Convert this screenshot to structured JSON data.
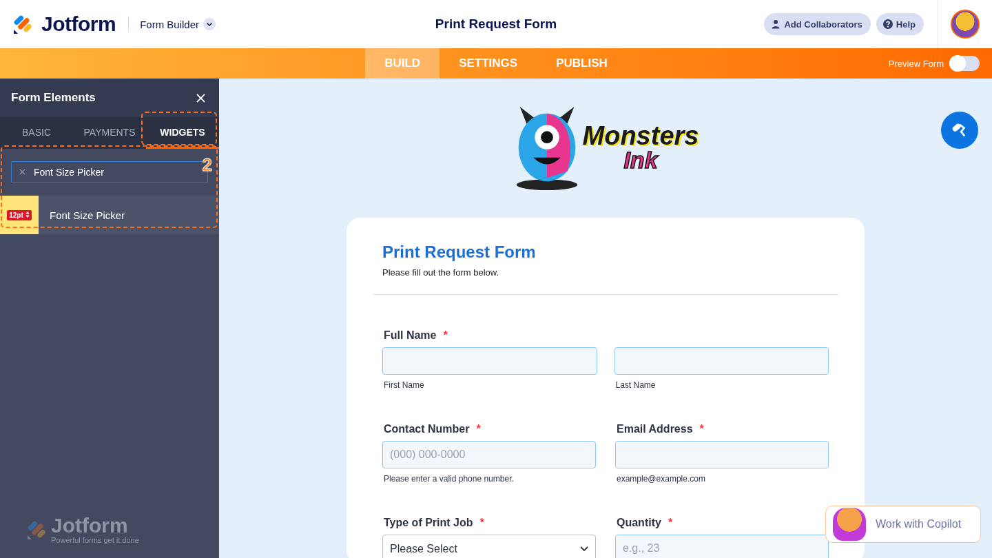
{
  "header": {
    "brand": "Jotform",
    "builder_menu": "Form Builder",
    "title": "Print Request Form",
    "buttons": [
      {
        "kind": "collaborators",
        "label": "Add Collaborators"
      },
      {
        "kind": "help",
        "label": "Help"
      }
    ]
  },
  "nav": {
    "tabs": [
      {
        "label": "BUILD",
        "selected": true
      },
      {
        "label": "SETTINGS",
        "selected": false
      },
      {
        "label": "PUBLISH",
        "selected": false
      }
    ],
    "preview": {
      "label": "Preview Form",
      "on": false
    }
  },
  "sidebar": {
    "title": "Form Elements",
    "tabs": [
      {
        "label": "BASIC",
        "selected": false
      },
      {
        "label": "PAYMENTS",
        "selected": false
      },
      {
        "label": "WIDGETS",
        "selected": true
      }
    ],
    "search": {
      "value": "Font Size Picker"
    },
    "items": [
      {
        "badge": "12pt",
        "label": "Font Size Picker"
      }
    ],
    "annotation": "2",
    "footer": {
      "brand": "Jotform",
      "tagline": "Powerful forms get it done"
    }
  },
  "form": {
    "required_mark": "*",
    "logo": {
      "line_1": "Monsters",
      "line_2": "Ink"
    },
    "title": "Print Request Form",
    "subtitle": "Please fill out the form below.",
    "rows": [
      [
        {
          "label": "Full Name",
          "required": true,
          "inputs": [
            {
              "kind": "text",
              "sublabel": "First Name"
            },
            {
              "kind": "text",
              "sublabel": "Last Name"
            }
          ]
        }
      ],
      [
        {
          "label": "Contact Number",
          "required": true,
          "inputs": [
            {
              "kind": "text",
              "placeholder": "(000) 000-0000",
              "sublabel": "Please enter a valid phone number."
            }
          ]
        },
        {
          "label": "Email Address",
          "required": true,
          "inputs": [
            {
              "kind": "text",
              "sublabel": "example@example.com"
            }
          ]
        }
      ],
      [
        {
          "label": "Type of Print Job",
          "required": true,
          "inputs": [
            {
              "kind": "select",
              "value": "Please Select"
            }
          ]
        },
        {
          "label": "Quantity",
          "required": true,
          "inputs": [
            {
              "kind": "text",
              "placeholder": "e.g., 23"
            }
          ]
        }
      ]
    ]
  },
  "copilot": {
    "label": "Work with Copilot"
  }
}
